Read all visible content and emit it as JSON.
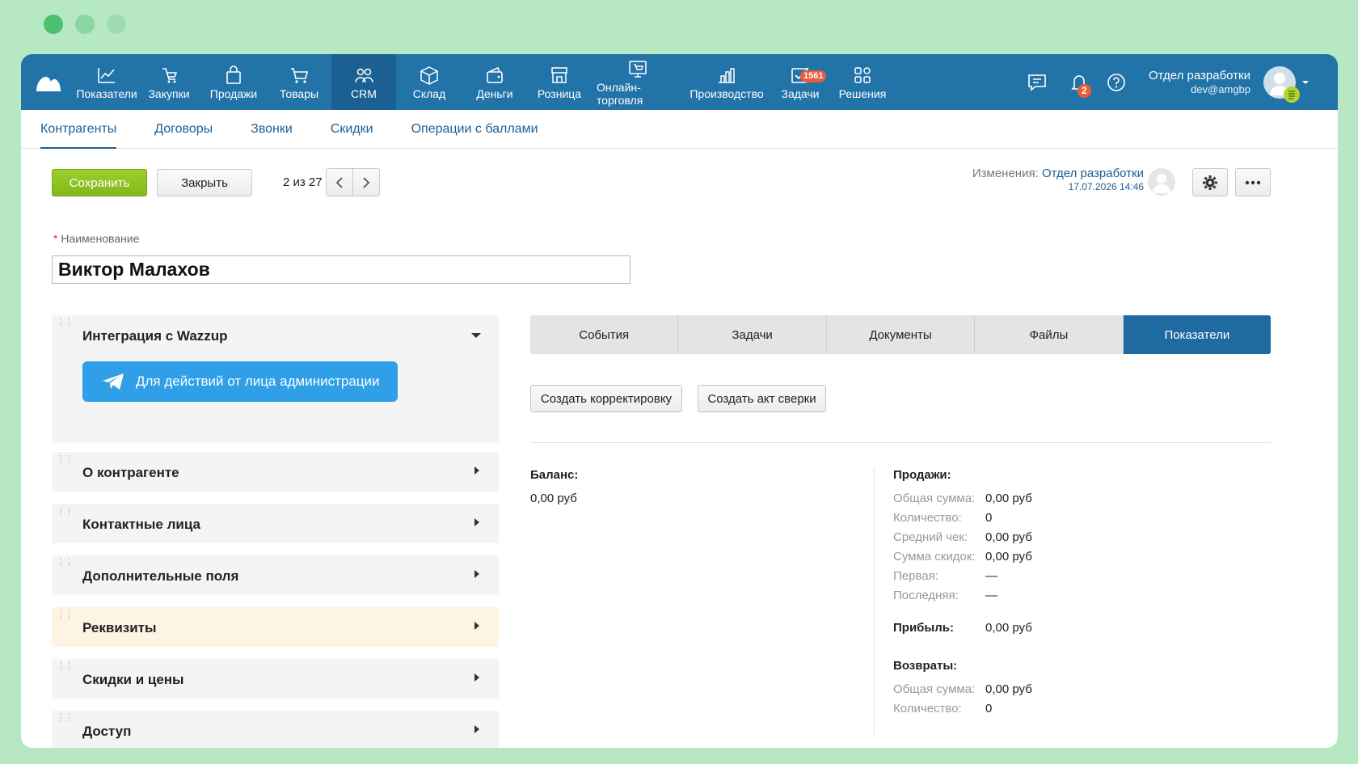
{
  "colors": {
    "bg": "#b6e8c4",
    "nav": "#2173a8",
    "nav_active": "#1a6092",
    "accent": "#1d5f94",
    "save": "#8dc424",
    "telegram": "#2f9fe8",
    "highlight": "#fdf4e4",
    "badge": "#e85b3a"
  },
  "traffic_lights": [
    "#4cc06e",
    "#8ad6a0",
    "#9edbb0"
  ],
  "nav": {
    "items": [
      {
        "label": "Показатели",
        "icon": "chart-line-icon"
      },
      {
        "label": "Закупки",
        "icon": "basket-icon"
      },
      {
        "label": "Продажи",
        "icon": "bag-icon"
      },
      {
        "label": "Товары",
        "icon": "cart-icon"
      },
      {
        "label": "CRM",
        "icon": "people-icon"
      },
      {
        "label": "Склад",
        "icon": "box-icon"
      },
      {
        "label": "Деньги",
        "icon": "wallet-icon"
      },
      {
        "label": "Розница",
        "icon": "store-icon"
      },
      {
        "label": "Онлайн-торговля",
        "icon": "online-store-icon"
      },
      {
        "label": "Производство",
        "icon": "factory-icon"
      },
      {
        "label": "Задачи",
        "icon": "checkbox-icon"
      },
      {
        "label": "Решения",
        "icon": "grid-icon"
      }
    ],
    "tasks_badge": "1561",
    "notifications_badge": "2",
    "user_name": "Отдел разработки",
    "user_email": "dev@amgbp"
  },
  "subnav": [
    "Контрагенты",
    "Договоры",
    "Звонки",
    "Скидки",
    "Операции с баллами"
  ],
  "toolbar": {
    "save": "Сохранить",
    "close": "Закрыть",
    "pager": "2 из 27",
    "changes_label": "Изменения:",
    "changes_user": "Отдел разработки",
    "changes_date": "17.07.2026 14:46"
  },
  "name_field": {
    "required_mark": "*",
    "label": "Наименование",
    "value": "Виктор Малахов"
  },
  "sections": [
    {
      "title": "Интеграция с Wazzup",
      "button": "Для действий от лица администрации"
    },
    {
      "title": "О контрагенте"
    },
    {
      "title": "Контактные лица"
    },
    {
      "title": "Дополнительные поля"
    },
    {
      "title": "Реквизиты"
    },
    {
      "title": "Скидки и цены"
    },
    {
      "title": "Доступ"
    }
  ],
  "tabs": [
    "События",
    "Задачи",
    "Документы",
    "Файлы",
    "Показатели"
  ],
  "actions": {
    "correction": "Создать корректировку",
    "reconciliation": "Создать акт сверки"
  },
  "balance": {
    "title": "Баланс:",
    "value": "0,00 руб"
  },
  "sales": {
    "title": "Продажи:",
    "rows": [
      {
        "label": "Общая сумма:",
        "value": "0,00 руб"
      },
      {
        "label": "Количество:",
        "value": "0"
      },
      {
        "label": "Средний чек:",
        "value": "0,00 руб"
      },
      {
        "label": "Сумма скидок:",
        "value": "0,00 руб"
      },
      {
        "label": "Первая:",
        "value": "—"
      },
      {
        "label": "Последняя:",
        "value": "—"
      }
    ]
  },
  "profit": {
    "title": "Прибыль:",
    "value": "0,00 руб"
  },
  "returns": {
    "title": "Возвраты:",
    "rows": [
      {
        "label": "Общая сумма:",
        "value": "0,00 руб"
      },
      {
        "label": "Количество:",
        "value": "0"
      }
    ]
  }
}
